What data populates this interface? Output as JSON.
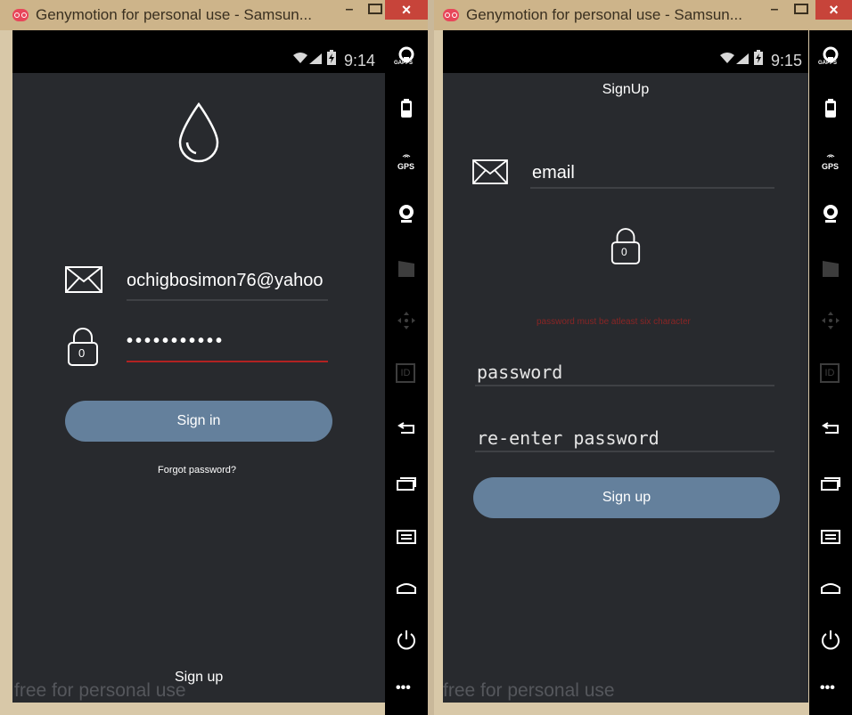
{
  "window_title": "Genymotion for personal use - Samsun...",
  "window_controls": {
    "minimize": "–",
    "close": "×"
  },
  "watermark": "free for personal use",
  "sidebar_labels": {
    "gps": "GPS",
    "id": "ID",
    "gapps": "GAPPS",
    "more": "•••"
  },
  "login": {
    "time": "9:14",
    "email_value": "ochigbosimon76@yahoo",
    "password_value": "•••••••••••",
    "lock_digit": "0",
    "sign_in_label": "Sign in",
    "forgot_password_label": "Forgot password?",
    "sign_up_label": "Sign up"
  },
  "signup": {
    "time": "9:15",
    "title": "SignUp",
    "email_placeholder": "email",
    "lock_digit": "0",
    "error_text": "password must be atleast six character",
    "password_placeholder": "password",
    "reenter_placeholder": "re-enter password",
    "sign_up_label": "Sign up"
  },
  "colors": {
    "accent_button": "#64809c",
    "error": "#8a2525",
    "focus_underline": "#b22222"
  }
}
